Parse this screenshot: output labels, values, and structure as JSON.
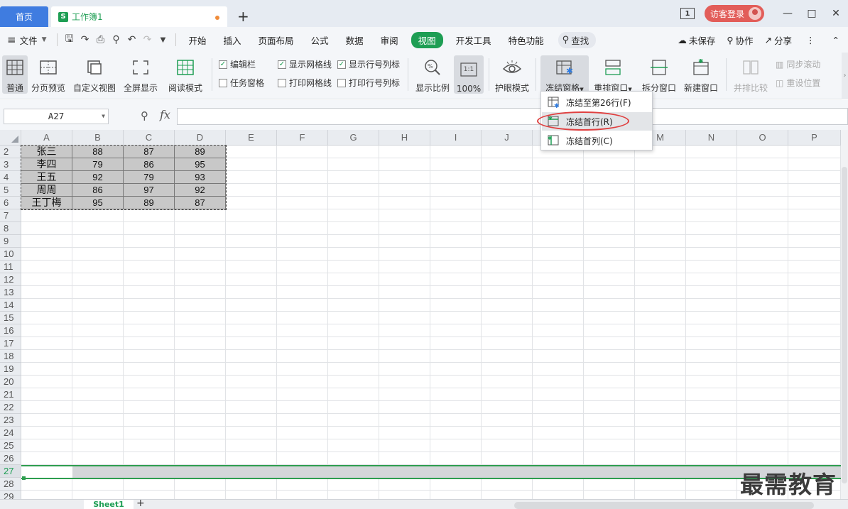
{
  "titlebar": {
    "home_tab": "首页",
    "doc_tab": "工作簿1",
    "doc_icon_letter": "S",
    "window_badge": "1",
    "login_label": "访客登录"
  },
  "menu": {
    "file": "文件",
    "items": [
      "开始",
      "插入",
      "页面布局",
      "公式",
      "数据",
      "审阅",
      "视图",
      "开发工具",
      "特色功能"
    ],
    "active": "视图",
    "search": "查找",
    "unsaved": "未保存",
    "collab": "协作",
    "share": "分享"
  },
  "ribbon": {
    "normal": "普通",
    "page_preview": "分页预览",
    "custom_view": "自定义视图",
    "fullscreen": "全屏显示",
    "reading": "阅读模式",
    "chk_formula_bar": "编辑栏",
    "chk_task_pane": "任务窗格",
    "chk_gridlines": "显示网格线",
    "chk_print_grid": "打印网格线",
    "chk_headers": "显示行号列标",
    "chk_print_headers": "打印行号列标",
    "zoom": "显示比例",
    "zoom100": "100%",
    "zoom_icon_text": "1:1",
    "eye_mode": "护眼模式",
    "freeze": "冻结窗格",
    "arrange": "重排窗口",
    "split": "拆分窗口",
    "new_window": "新建窗口",
    "side_by_side": "并排比较",
    "sync_scroll": "同步滚动",
    "reset_pos": "重设位置"
  },
  "formula_bar": {
    "name_box": "A27",
    "fx": "fx",
    "value": ""
  },
  "grid": {
    "columns": [
      "A",
      "B",
      "C",
      "D",
      "E",
      "F",
      "G",
      "H",
      "I",
      "J",
      "K",
      "L",
      "M",
      "N",
      "O",
      "P"
    ],
    "rows": [
      "2",
      "3",
      "4",
      "5",
      "6",
      "7",
      "8",
      "9",
      "10",
      "11",
      "12",
      "13",
      "14",
      "15",
      "16",
      "17",
      "18",
      "19",
      "20",
      "21",
      "22",
      "23",
      "24",
      "25",
      "26",
      "27",
      "28",
      "29"
    ],
    "data": [
      [
        "张三",
        "88",
        "87",
        "89"
      ],
      [
        "李四",
        "79",
        "86",
        "95"
      ],
      [
        "王五",
        "92",
        "79",
        "93"
      ],
      [
        "周周",
        "86",
        "97",
        "92"
      ],
      [
        "王丁梅",
        "95",
        "89",
        "87"
      ]
    ],
    "selected_row": "27"
  },
  "freeze_menu": {
    "items": [
      "冻结至第26行(F)",
      "冻结首行(R)",
      "冻结首列(C)"
    ],
    "highlighted": "冻结首行(R)"
  },
  "sheets": {
    "tabs": [
      "Sheet1"
    ],
    "add": "+"
  },
  "watermark": "最需教育"
}
